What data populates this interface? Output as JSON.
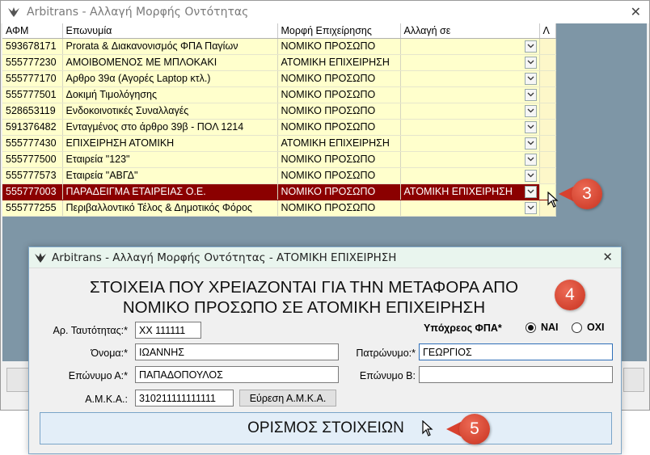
{
  "main_window": {
    "title": "Arbitrans - Αλλαγή Μορφής Οντότητας",
    "close_glyph": "✕"
  },
  "grid": {
    "columns": [
      "ΑΦΜ",
      "Επωνυμία",
      "Μορφή Επιχείρησης",
      "Αλλαγή σε",
      "Λ"
    ],
    "rows": [
      {
        "afm": "593678171",
        "name": "Prorata & Διακανονισμός ΦΠΑ Παγίων",
        "form": "ΝΟΜΙΚΟ ΠΡΟΣΩΠΟ",
        "change": ""
      },
      {
        "afm": "555777230",
        "name": "ΑΜΟΙΒΟΜΕΝΟΣ ΜΕ ΜΠΛΟΚΑΚΙ",
        "form": "ΑΤΟΜΙΚΗ ΕΠΙΧΕΙΡΗΣΗ",
        "change": ""
      },
      {
        "afm": "555777170",
        "name": "Αρθρο 39α (Αγορές Laptop κτλ.)",
        "form": "ΝΟΜΙΚΟ ΠΡΟΣΩΠΟ",
        "change": ""
      },
      {
        "afm": "555777501",
        "name": "Δοκιμή Τιμολόγησης",
        "form": "ΝΟΜΙΚΟ ΠΡΟΣΩΠΟ",
        "change": ""
      },
      {
        "afm": "528653119",
        "name": "Ενδοκοινοτικές Συναλλαγές",
        "form": "ΝΟΜΙΚΟ ΠΡΟΣΩΠΟ",
        "change": ""
      },
      {
        "afm": "591376482",
        "name": "Ενταγμένος στο άρθρο 39β - ΠΟΛ 1214",
        "form": "ΝΟΜΙΚΟ ΠΡΟΣΩΠΟ",
        "change": ""
      },
      {
        "afm": "555777430",
        "name": "ΕΠΙΧΕΙΡΗΣΗ ΑΤΟΜΙΚΗ",
        "form": "ΑΤΟΜΙΚΗ ΕΠΙΧΕΙΡΗΣΗ",
        "change": ""
      },
      {
        "afm": "555777500",
        "name": "Εταιρεία \"123\"",
        "form": "ΝΟΜΙΚΟ ΠΡΟΣΩΠΟ",
        "change": ""
      },
      {
        "afm": "555777573",
        "name": "Εταιρεία \"ΑΒΓΔ\"",
        "form": "ΝΟΜΙΚΟ ΠΡΟΣΩΠΟ",
        "change": ""
      },
      {
        "afm": "555777003",
        "name": "ΠΑΡΑΔΕΙΓΜΑ ΕΤΑΙΡΕΙΑΣ Ο.Ε.",
        "form": "ΝΟΜΙΚΟ ΠΡΟΣΩΠΟ",
        "change": "ΑΤΟΜΙΚΗ ΕΠΙΧΕΙΡΗΣΗ",
        "selected": true
      },
      {
        "afm": "555777255",
        "name": "Περιβαλλοντικό Τέλος & Δημοτικός Φόρος",
        "form": "ΝΟΜΙΚΟ ΠΡΟΣΩΠΟ",
        "change": ""
      }
    ]
  },
  "callouts": {
    "step3": "3",
    "step4": "4",
    "step5": "5"
  },
  "dialog": {
    "title": "Arbitrans - Αλλαγή Μορφής Οντότητας - ΑΤΟΜΙΚΗ ΕΠΙΧΕΙΡΗΣΗ",
    "close_glyph": "✕",
    "heading_line1": "ΣΤΟΙΧΕΙΑ ΠΟΥ ΧΡΕΙΑΖΟΝΤΑΙ ΓΙΑ ΤΗΝ ΜΕΤΑΦΟΡΑ ΑΠΟ",
    "heading_line2": "ΝΟΜΙΚΟ ΠΡΟΣΩΠΟ ΣΕ ΑΤΟΜΙΚΗ ΕΠΙΧΕΙΡΗΣΗ",
    "id_label": "Αρ. Ταυτότητας:*",
    "id_value": "ΧΧ 111111",
    "vat_label": "Υπόχρεος ΦΠΑ*",
    "vat_yes": "ΝΑΙ",
    "vat_no": "ΟΧΙ",
    "vat_selected": "ΝΑΙ",
    "first_name_label": "Όνομα:*",
    "first_name_value": "ΙΩΑΝΝΗΣ",
    "father_label": "Πατρώνυμο:*",
    "father_value": "ΓΕΩΡΓΙΟΣ",
    "surname_a_label": "Επώνυμο Α:*",
    "surname_a_value": "ΠΑΠΑΔΟΠΟΥΛΟΣ",
    "surname_b_label": "Επώνυμο Β:",
    "surname_b_value": "",
    "amka_label": "Α.Μ.Κ.Α.:",
    "amka_value": "310211111111111",
    "find_amka_button": "Εύρεση Α.Μ.Κ.Α.",
    "submit_button": "ΟΡΙΣΜΟΣ ΣΤΟΙΧΕΙΩΝ"
  },
  "colors": {
    "selected_row": "#8b0000",
    "grid_row": "#ffffcc",
    "callout": "#d8412f",
    "grid_bg": "#7e96a6"
  }
}
